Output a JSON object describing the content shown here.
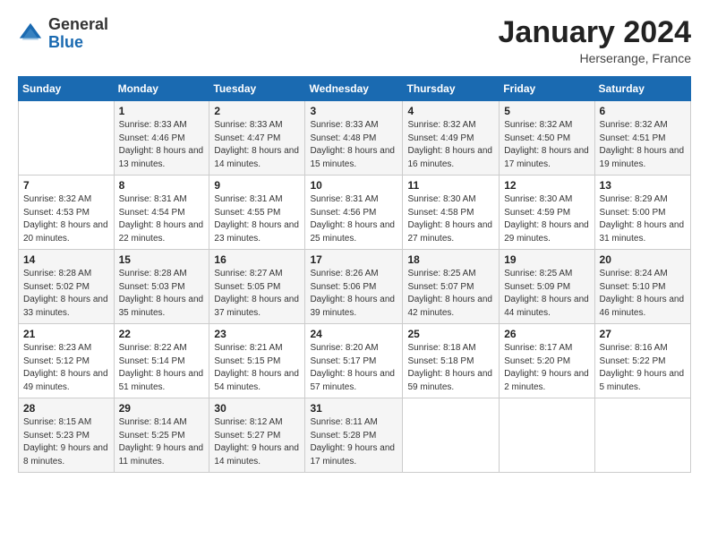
{
  "header": {
    "logo_general": "General",
    "logo_blue": "Blue",
    "month_title": "January 2024",
    "subtitle": "Herserange, France"
  },
  "weekdays": [
    "Sunday",
    "Monday",
    "Tuesday",
    "Wednesday",
    "Thursday",
    "Friday",
    "Saturday"
  ],
  "weeks": [
    [
      {
        "day": "",
        "info": ""
      },
      {
        "day": "1",
        "info": "Sunrise: 8:33 AM\nSunset: 4:46 PM\nDaylight: 8 hours\nand 13 minutes."
      },
      {
        "day": "2",
        "info": "Sunrise: 8:33 AM\nSunset: 4:47 PM\nDaylight: 8 hours\nand 14 minutes."
      },
      {
        "day": "3",
        "info": "Sunrise: 8:33 AM\nSunset: 4:48 PM\nDaylight: 8 hours\nand 15 minutes."
      },
      {
        "day": "4",
        "info": "Sunrise: 8:32 AM\nSunset: 4:49 PM\nDaylight: 8 hours\nand 16 minutes."
      },
      {
        "day": "5",
        "info": "Sunrise: 8:32 AM\nSunset: 4:50 PM\nDaylight: 8 hours\nand 17 minutes."
      },
      {
        "day": "6",
        "info": "Sunrise: 8:32 AM\nSunset: 4:51 PM\nDaylight: 8 hours\nand 19 minutes."
      }
    ],
    [
      {
        "day": "7",
        "info": "Sunrise: 8:32 AM\nSunset: 4:53 PM\nDaylight: 8 hours\nand 20 minutes."
      },
      {
        "day": "8",
        "info": "Sunrise: 8:31 AM\nSunset: 4:54 PM\nDaylight: 8 hours\nand 22 minutes."
      },
      {
        "day": "9",
        "info": "Sunrise: 8:31 AM\nSunset: 4:55 PM\nDaylight: 8 hours\nand 23 minutes."
      },
      {
        "day": "10",
        "info": "Sunrise: 8:31 AM\nSunset: 4:56 PM\nDaylight: 8 hours\nand 25 minutes."
      },
      {
        "day": "11",
        "info": "Sunrise: 8:30 AM\nSunset: 4:58 PM\nDaylight: 8 hours\nand 27 minutes."
      },
      {
        "day": "12",
        "info": "Sunrise: 8:30 AM\nSunset: 4:59 PM\nDaylight: 8 hours\nand 29 minutes."
      },
      {
        "day": "13",
        "info": "Sunrise: 8:29 AM\nSunset: 5:00 PM\nDaylight: 8 hours\nand 31 minutes."
      }
    ],
    [
      {
        "day": "14",
        "info": "Sunrise: 8:28 AM\nSunset: 5:02 PM\nDaylight: 8 hours\nand 33 minutes."
      },
      {
        "day": "15",
        "info": "Sunrise: 8:28 AM\nSunset: 5:03 PM\nDaylight: 8 hours\nand 35 minutes."
      },
      {
        "day": "16",
        "info": "Sunrise: 8:27 AM\nSunset: 5:05 PM\nDaylight: 8 hours\nand 37 minutes."
      },
      {
        "day": "17",
        "info": "Sunrise: 8:26 AM\nSunset: 5:06 PM\nDaylight: 8 hours\nand 39 minutes."
      },
      {
        "day": "18",
        "info": "Sunrise: 8:25 AM\nSunset: 5:07 PM\nDaylight: 8 hours\nand 42 minutes."
      },
      {
        "day": "19",
        "info": "Sunrise: 8:25 AM\nSunset: 5:09 PM\nDaylight: 8 hours\nand 44 minutes."
      },
      {
        "day": "20",
        "info": "Sunrise: 8:24 AM\nSunset: 5:10 PM\nDaylight: 8 hours\nand 46 minutes."
      }
    ],
    [
      {
        "day": "21",
        "info": "Sunrise: 8:23 AM\nSunset: 5:12 PM\nDaylight: 8 hours\nand 49 minutes."
      },
      {
        "day": "22",
        "info": "Sunrise: 8:22 AM\nSunset: 5:14 PM\nDaylight: 8 hours\nand 51 minutes."
      },
      {
        "day": "23",
        "info": "Sunrise: 8:21 AM\nSunset: 5:15 PM\nDaylight: 8 hours\nand 54 minutes."
      },
      {
        "day": "24",
        "info": "Sunrise: 8:20 AM\nSunset: 5:17 PM\nDaylight: 8 hours\nand 57 minutes."
      },
      {
        "day": "25",
        "info": "Sunrise: 8:18 AM\nSunset: 5:18 PM\nDaylight: 8 hours\nand 59 minutes."
      },
      {
        "day": "26",
        "info": "Sunrise: 8:17 AM\nSunset: 5:20 PM\nDaylight: 9 hours\nand 2 minutes."
      },
      {
        "day": "27",
        "info": "Sunrise: 8:16 AM\nSunset: 5:22 PM\nDaylight: 9 hours\nand 5 minutes."
      }
    ],
    [
      {
        "day": "28",
        "info": "Sunrise: 8:15 AM\nSunset: 5:23 PM\nDaylight: 9 hours\nand 8 minutes."
      },
      {
        "day": "29",
        "info": "Sunrise: 8:14 AM\nSunset: 5:25 PM\nDaylight: 9 hours\nand 11 minutes."
      },
      {
        "day": "30",
        "info": "Sunrise: 8:12 AM\nSunset: 5:27 PM\nDaylight: 9 hours\nand 14 minutes."
      },
      {
        "day": "31",
        "info": "Sunrise: 8:11 AM\nSunset: 5:28 PM\nDaylight: 9 hours\nand 17 minutes."
      },
      {
        "day": "",
        "info": ""
      },
      {
        "day": "",
        "info": ""
      },
      {
        "day": "",
        "info": ""
      }
    ]
  ]
}
